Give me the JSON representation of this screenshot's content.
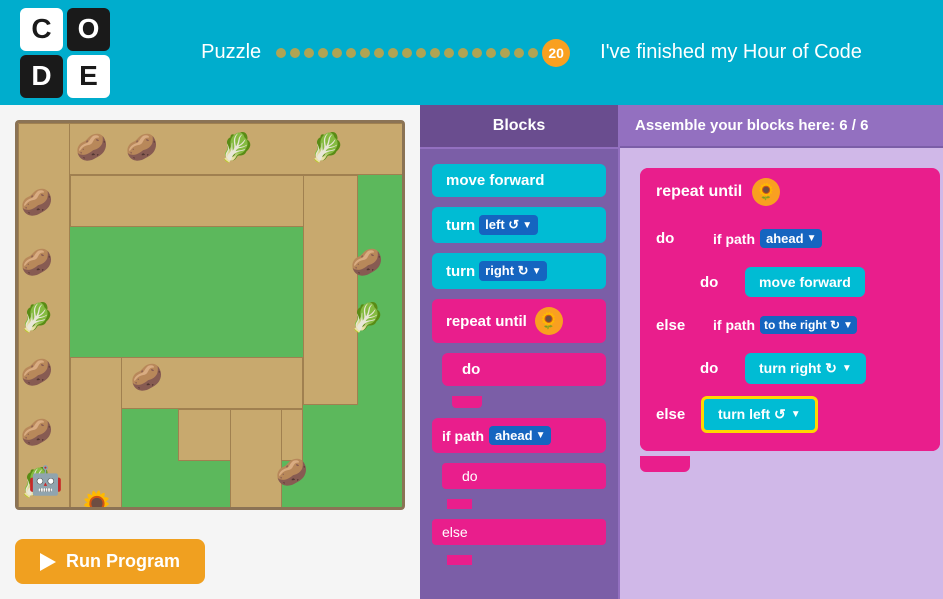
{
  "header": {
    "logo": {
      "c": "C",
      "o": "O",
      "d": "D",
      "e": "E"
    },
    "puzzle_label": "Puzzle",
    "puzzle_number": "20",
    "finished_label": "I've finished my Hour of Code",
    "dot_count": 20
  },
  "blocks_panel": {
    "header": "Blocks",
    "blocks": [
      {
        "id": "move-forward",
        "label": "move forward",
        "type": "cyan"
      },
      {
        "id": "turn-left",
        "label": "turn",
        "dropdown": "left ↺",
        "type": "cyan"
      },
      {
        "id": "turn-right",
        "label": "turn",
        "dropdown": "right ↻",
        "type": "cyan"
      },
      {
        "id": "repeat-until",
        "label": "repeat until",
        "type": "pink",
        "has_icon": true
      },
      {
        "id": "do",
        "label": "do",
        "type": "pink"
      },
      {
        "id": "if-path",
        "label": "if path",
        "dropdown": "ahead",
        "type": "pink"
      },
      {
        "id": "do2",
        "label": "do",
        "type": "pink"
      },
      {
        "id": "else",
        "label": "else",
        "type": "pink"
      }
    ]
  },
  "assembly_panel": {
    "header": "Assemble your blocks here: 6 / 6",
    "repeat_block": {
      "label": "repeat until"
    },
    "do_label": "do",
    "else_label": "else",
    "inner": {
      "if_path_label": "if path",
      "ahead_dropdown": "ahead",
      "do_label": "do",
      "move_forward_label": "move forward",
      "else_label": "else",
      "if_path2_label": "if path",
      "to_right_dropdown": "to the right ↻",
      "do2_label": "do",
      "turn_right_label": "turn right ↻",
      "else2_label": "else",
      "turn_left_label": "turn left ↺"
    }
  },
  "run_button": {
    "label": "Run Program"
  },
  "colors": {
    "cyan": "#00bcd4",
    "pink": "#e91e8c",
    "purple_dark": "#7b5ea7",
    "purple_light": "#d0b8e8",
    "header_bg": "#00adcd",
    "dot_color": "#f9a020",
    "gold": "#ffd700"
  }
}
